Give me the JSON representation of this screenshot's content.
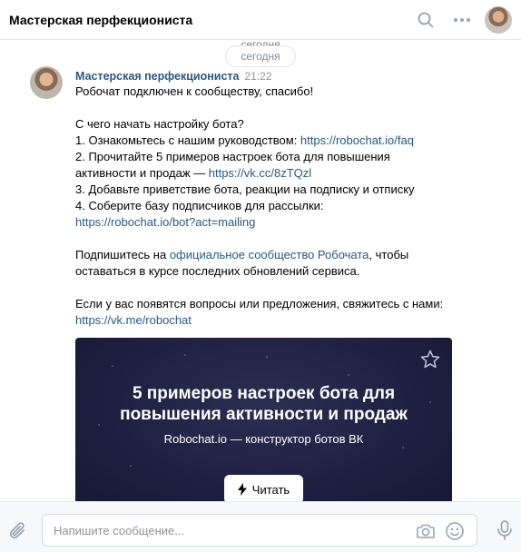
{
  "header": {
    "title": "Мастерская перфекциониста",
    "icons": [
      "search-icon",
      "more-icon",
      "avatar"
    ]
  },
  "date_divider": {
    "ghost_label": "сегодня",
    "label": "сегодня"
  },
  "message": {
    "author": "Мастерская перфекциониста",
    "time": "21:22",
    "lines": {
      "l1": "Робочат подключен к сообществу, спасибо!",
      "l2": "С чего начать настройку бота?",
      "l3_text": "1. Ознакомьтесь с нашим руководством: ",
      "l3_link": "https://robochat.io/faq",
      "l4": "2. Прочитайте 5 примеров настроек бота для повышения",
      "l5_text": "активности и продаж — ",
      "l5_link": "https://vk.cc/8zTQzl",
      "l6": "3. Добавьте приветствие бота, реакции на подписку и отписку",
      "l7": "4. Соберите базу подписчиков для рассылки:",
      "l8_link": "https://robochat.io/bot?act=mailing",
      "l9_text": "Подпишитесь на ",
      "l9_link": "официальное сообщество Робочата",
      "l9_tail": ", чтобы",
      "l10": "оставаться в курсе последних обновлений сервиса.",
      "l11": "Если у вас появятся вопросы или предложения, свяжитесь с нами:",
      "l12_link": "https://vk.me/robochat"
    }
  },
  "card": {
    "title_line1": "5 примеров настроек бота для",
    "title_line2": "повышения активности и продаж",
    "subtitle": "Robochat.io — конструктор ботов ВК",
    "button_label": "Читать",
    "background_color": "#1d2040"
  },
  "composer": {
    "placeholder": "Напишите сообщение..."
  },
  "colors": {
    "link": "#2a5885",
    "muted": "#818c99",
    "composer_bg": "#f7f8fa"
  }
}
